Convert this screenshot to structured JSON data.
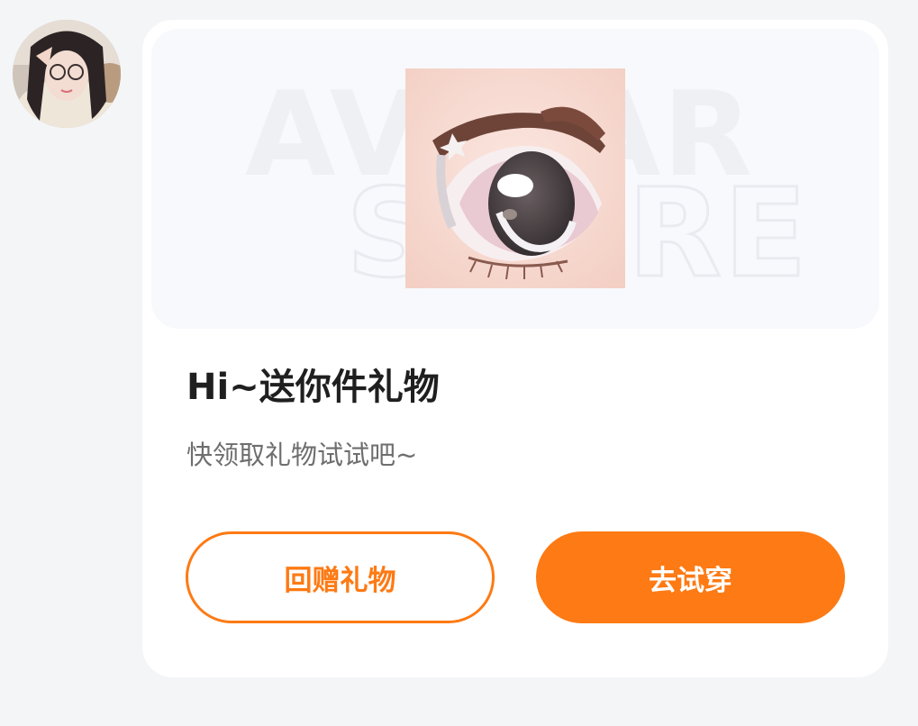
{
  "avatar": {
    "alt": "user-avatar"
  },
  "banner": {
    "watermark_line1": "AVATAR",
    "watermark_line2": "STORE",
    "gift_image": "anime-eye-item-image"
  },
  "card": {
    "title": "Hi~送你件礼物",
    "subtitle": "快领取礼物试试吧~"
  },
  "actions": {
    "return_gift_label": "回赠礼物",
    "try_on_label": "去试穿"
  },
  "colors": {
    "accent": "#fd7a14",
    "page_bg": "#f4f5f7",
    "card_bg": "#ffffff",
    "title_text": "#1f1f1f",
    "subtitle_text": "#6e6e6e"
  }
}
